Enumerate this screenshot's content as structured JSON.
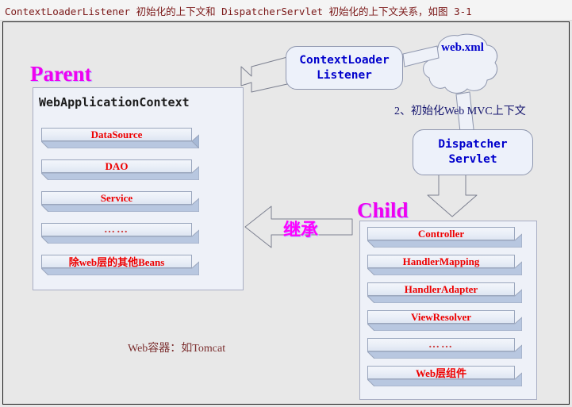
{
  "caption": {
    "text": "ContextLoaderListener 初始化的上下文和 DispatcherServlet 初始化的上下文关系，如图 3-1"
  },
  "colors": {
    "background": "#e8e8e8",
    "panel_fill": "#eef1f8",
    "panel_border": "#a9aec4",
    "bar_face": "#eef2f9",
    "bar_depth": "#b6c6e0",
    "bar_text": "#ee0000",
    "title_magenta": "#f000f0",
    "box_text_blue": "#0000cc",
    "caption_text": "#7b1818",
    "container_label": "#7c3030"
  },
  "parent": {
    "title": "Parent",
    "panel_label": "WebApplicationContext",
    "beans": [
      {
        "label": "DataSource",
        "is_dots": false
      },
      {
        "label": "DAO",
        "is_dots": false
      },
      {
        "label": "Service",
        "is_dots": false
      },
      {
        "label": "……",
        "is_dots": true
      },
      {
        "label": "除web层的其他Beans",
        "is_dots": false
      }
    ]
  },
  "child": {
    "title": "Child",
    "beans": [
      {
        "label": "Controller",
        "is_dots": false
      },
      {
        "label": "HandlerMapping",
        "is_dots": false
      },
      {
        "label": "HandlerAdapter",
        "is_dots": false
      },
      {
        "label": "ViewResolver",
        "is_dots": false
      },
      {
        "label": "……",
        "is_dots": true
      },
      {
        "label": "Web层组件",
        "is_dots": false
      }
    ]
  },
  "nodes": {
    "context_loader_listener": "ContextLoader\nListener",
    "dispatcher_servlet": "Dispatcher\nServlet",
    "web_xml": "web.xml"
  },
  "labels": {
    "init_mvc_context": "2、初始化Web MVC上下文",
    "inheritance": "继承",
    "web_container": "Web容器：如Tomcat"
  }
}
